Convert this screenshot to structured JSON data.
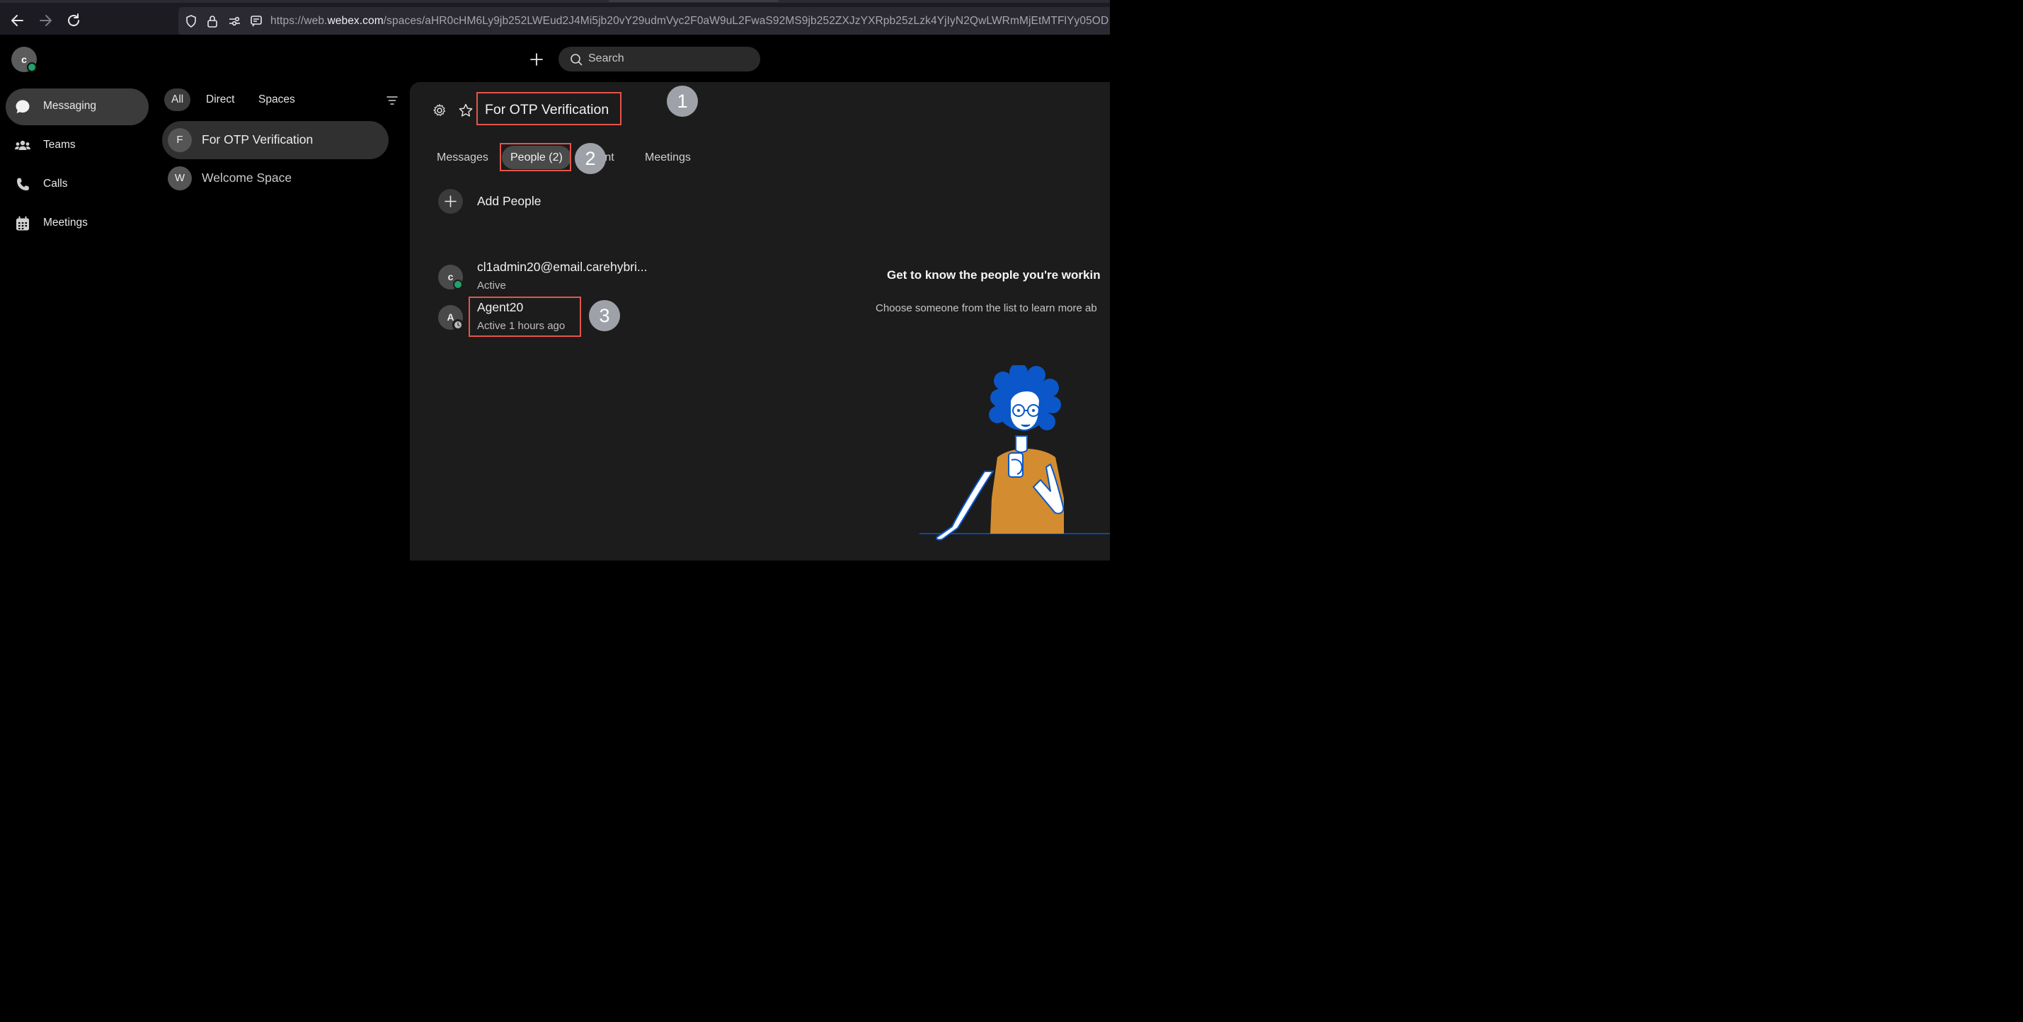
{
  "browser": {
    "url_prefix": "https://web.",
    "url_domain": "webex.com",
    "url_path": "/spaces/aHR0cHM6Ly9jb252LWEud2J4Mi5jb20vY29udmVyc2F0aW9uL2FwaS92MS9jb252ZXJzYXRpb25zLzk4YjIyN2QwLWRmMjEtMTFlYy05OD"
  },
  "self": {
    "initial": "c"
  },
  "header": {
    "search_placeholder": "Search"
  },
  "nav": {
    "items": [
      {
        "label": "Messaging",
        "icon": "chat-bubble-icon",
        "active": true
      },
      {
        "label": "Teams",
        "icon": "teams-icon"
      },
      {
        "label": "Calls",
        "icon": "phone-icon"
      },
      {
        "label": "Meetings",
        "icon": "calendar-icon"
      }
    ]
  },
  "filters": {
    "all": "All",
    "direct": "Direct",
    "spaces": "Spaces"
  },
  "spaces": [
    {
      "initial": "F",
      "name": "For OTP Verification",
      "active": true
    },
    {
      "initial": "W",
      "name": "Welcome Space"
    }
  ],
  "space": {
    "title": "For OTP Verification",
    "tabs": {
      "messages": "Messages",
      "people": "People (2)",
      "content": "tent",
      "meetings": "Meetings"
    },
    "add_people": "Add People",
    "people": [
      {
        "initial": "c",
        "name": "cl1admin20@email.carehybri...",
        "status": "Active",
        "presence": "active"
      },
      {
        "initial": "A",
        "name": "Agent20",
        "status": "Active 1 hours ago",
        "presence": "away"
      }
    ],
    "info_title": "Get to know the people you're workin",
    "info_subtitle": "Choose someone from the list to learn more ab"
  },
  "annotations": [
    "1",
    "2",
    "3"
  ],
  "colors": {
    "annotation_red": "#e5544b",
    "annotation_badge": "#9ea2a8",
    "presence_green": "#1fa36b",
    "illustration_blue": "#0b57c9",
    "illustration_orange": "#d38c2f"
  }
}
